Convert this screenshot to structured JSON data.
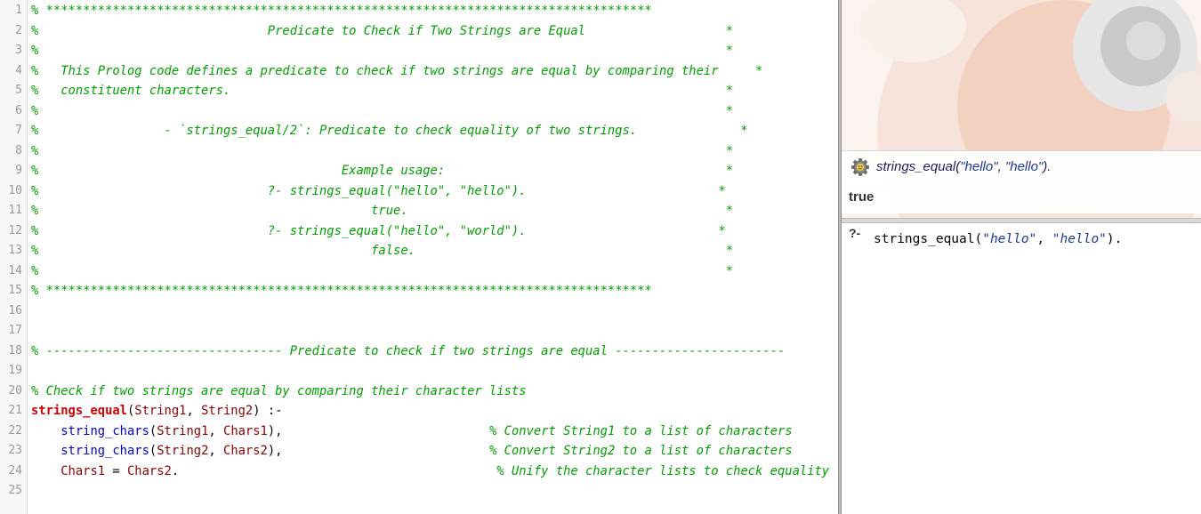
{
  "editor": {
    "lines": [
      {
        "n": "1",
        "segs": [
          {
            "c": "cm",
            "t": "% **********************************************************************************"
          }
        ]
      },
      {
        "n": "2",
        "segs": [
          {
            "c": "cm",
            "t": "%                               Predicate to Check if Two Strings are Equal                   *"
          }
        ]
      },
      {
        "n": "3",
        "segs": [
          {
            "c": "cm",
            "t": "%                                                                                             *"
          }
        ]
      },
      {
        "n": "4",
        "segs": [
          {
            "c": "cm",
            "t": "%   This Prolog code defines a predicate to check if two strings are equal by comparing their     *"
          }
        ]
      },
      {
        "n": "5",
        "segs": [
          {
            "c": "cm",
            "t": "%   constituent characters.                                                                   *"
          }
        ]
      },
      {
        "n": "6",
        "segs": [
          {
            "c": "cm",
            "t": "%                                                                                             *"
          }
        ]
      },
      {
        "n": "7",
        "segs": [
          {
            "c": "cm",
            "t": "%                 - `strings_equal/2`: Predicate to check equality of two strings.              *"
          }
        ]
      },
      {
        "n": "8",
        "segs": [
          {
            "c": "cm",
            "t": "%                                                                                             *"
          }
        ]
      },
      {
        "n": "9",
        "segs": [
          {
            "c": "cm",
            "t": "%                                         Example usage:                                      *"
          }
        ]
      },
      {
        "n": "10",
        "segs": [
          {
            "c": "cm",
            "t": "%                               ?- strings_equal(\"hello\", \"hello\").                          *"
          }
        ]
      },
      {
        "n": "11",
        "segs": [
          {
            "c": "cm",
            "t": "%                                             true.                                           *"
          }
        ]
      },
      {
        "n": "12",
        "segs": [
          {
            "c": "cm",
            "t": "%                               ?- strings_equal(\"hello\", \"world\").                          *"
          }
        ]
      },
      {
        "n": "13",
        "segs": [
          {
            "c": "cm",
            "t": "%                                             false.                                          *"
          }
        ]
      },
      {
        "n": "14",
        "segs": [
          {
            "c": "cm",
            "t": "%                                                                                             *"
          }
        ]
      },
      {
        "n": "15",
        "segs": [
          {
            "c": "cm",
            "t": "% **********************************************************************************"
          }
        ]
      },
      {
        "n": "16",
        "segs": []
      },
      {
        "n": "17",
        "segs": []
      },
      {
        "n": "18",
        "segs": [
          {
            "c": "cm",
            "t": "% -------------------------------- Predicate to check if two strings are equal -----------------------"
          }
        ]
      },
      {
        "n": "19",
        "segs": []
      },
      {
        "n": "20",
        "segs": [
          {
            "c": "cm",
            "t": "% Check if two strings are equal by comparing their character lists"
          }
        ]
      },
      {
        "n": "21",
        "segs": [
          {
            "c": "head",
            "t": "strings_equal"
          },
          {
            "c": "pl",
            "t": "("
          },
          {
            "c": "var",
            "t": "String1"
          },
          {
            "c": "pl",
            "t": ", "
          },
          {
            "c": "var",
            "t": "String2"
          },
          {
            "c": "pl",
            "t": ") :-"
          }
        ]
      },
      {
        "n": "22",
        "segs": [
          {
            "c": "pl",
            "t": "    "
          },
          {
            "c": "bi",
            "t": "string_chars"
          },
          {
            "c": "pl",
            "t": "("
          },
          {
            "c": "var",
            "t": "String1"
          },
          {
            "c": "pl",
            "t": ", "
          },
          {
            "c": "var",
            "t": "Chars1"
          },
          {
            "c": "pl",
            "t": "),                            "
          },
          {
            "c": "cm",
            "t": "% Convert String1 to a list of characters"
          }
        ]
      },
      {
        "n": "23",
        "segs": [
          {
            "c": "pl",
            "t": "    "
          },
          {
            "c": "bi",
            "t": "string_chars"
          },
          {
            "c": "pl",
            "t": "("
          },
          {
            "c": "var",
            "t": "String2"
          },
          {
            "c": "pl",
            "t": ", "
          },
          {
            "c": "var",
            "t": "Chars2"
          },
          {
            "c": "pl",
            "t": "),                            "
          },
          {
            "c": "cm",
            "t": "% Convert String2 to a list of characters"
          }
        ]
      },
      {
        "n": "24",
        "segs": [
          {
            "c": "pl",
            "t": "    "
          },
          {
            "c": "var",
            "t": "Chars1"
          },
          {
            "c": "pl",
            "t": " = "
          },
          {
            "c": "var",
            "t": "Chars2"
          },
          {
            "c": "pl",
            "t": ".                                           "
          },
          {
            "c": "cm",
            "t": "% Unify the character lists to check equality"
          }
        ]
      },
      {
        "n": "25",
        "segs": []
      }
    ]
  },
  "runner": {
    "query_pred": "strings_equal(",
    "query_arg1": "\"hello\"",
    "query_sep": ", ",
    "query_arg2": "\"hello\"",
    "query_end": ").",
    "answer": "true",
    "prompt": "?-",
    "input_pred": "strings_equal(",
    "input_arg1": "\"hello\"",
    "input_sep": ", ",
    "input_arg2": "\"hello\"",
    "input_end": ")."
  },
  "colors": {
    "comment": "#00a000",
    "head": "#cc0000",
    "variable": "#8b0000",
    "builtin": "#0000cc",
    "string": "#1a3a9a"
  },
  "icons": [
    "gear-icon",
    "swish-logo-art"
  ]
}
